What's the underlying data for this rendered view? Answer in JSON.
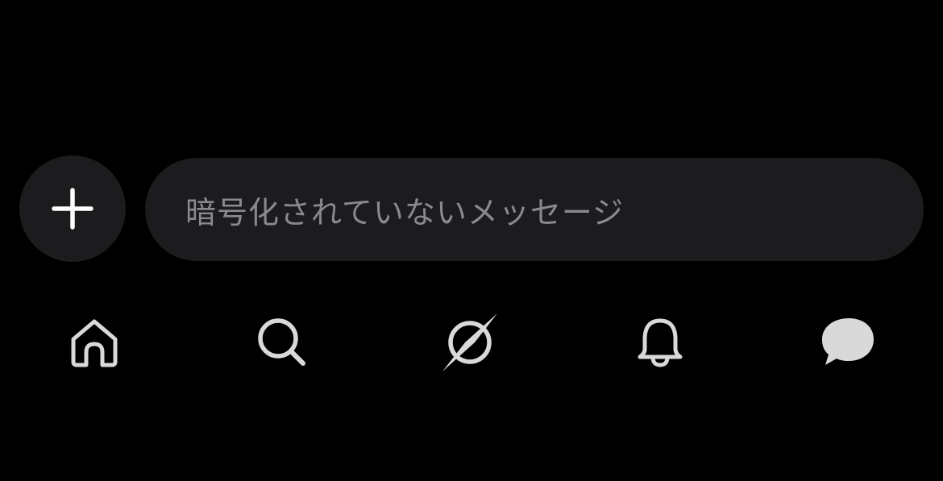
{
  "composer": {
    "add_icon": "plus-icon",
    "placeholder": "暗号化されていないメッセージ"
  },
  "tabbar": {
    "tabs": [
      {
        "name": "home",
        "icon": "home-icon"
      },
      {
        "name": "search",
        "icon": "search-icon"
      },
      {
        "name": "discover",
        "icon": "compass-icon"
      },
      {
        "name": "notifications",
        "icon": "bell-icon"
      },
      {
        "name": "messages",
        "icon": "chat-bubble-icon",
        "active": true
      }
    ]
  },
  "colors": {
    "background": "#000000",
    "surface": "#1c1c1e",
    "placeholder_text": "#8a8a8e",
    "icon": "#d9d9d9"
  }
}
